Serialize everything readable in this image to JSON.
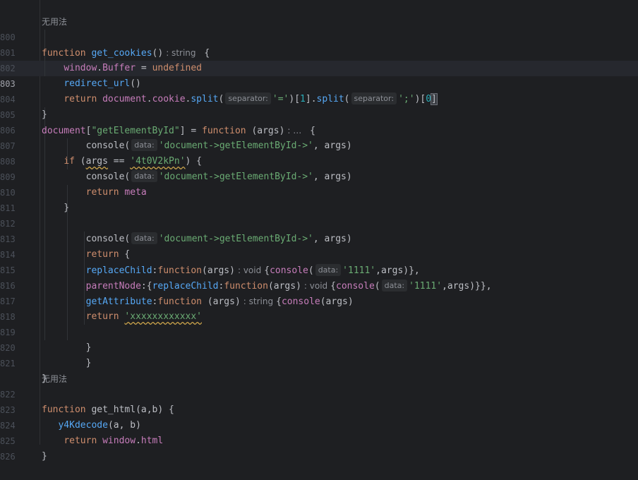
{
  "usage_label_1": "无用法",
  "usage_label_2": "无用法",
  "line_numbers": [
    "800",
    "801",
    "802",
    "803",
    "804",
    "805",
    "806",
    "807",
    "808",
    "809",
    "810",
    "811",
    "812",
    "813",
    "814",
    "815",
    "816",
    "817",
    "818",
    "819",
    "820",
    "821",
    "822",
    "823",
    "824",
    "825",
    "826"
  ],
  "hints": {
    "data": "data:",
    "separator": "separator:",
    "type_string": ": string",
    "type_void": ": void",
    "ellipsis": ": …"
  },
  "code": {
    "l800": {
      "kw": "function",
      "name": "get_cookies",
      "parens": "()"
    },
    "l801": {
      "obj": "window",
      "prop": "Buffer",
      "eq": " = ",
      "val": "undefined"
    },
    "l802": {
      "call": "redirect_url",
      "parens": "()"
    },
    "l803": {
      "kw": "return",
      "doc": "document",
      "prop": "cookie",
      "split": "split",
      "sep1": "'='",
      "idx1": "1",
      "sep2": "';'",
      "idx2": "0"
    },
    "l805": {
      "doc": "document",
      "key": "\"getElementById\"",
      "eq": "] = ",
      "kw": "function",
      "args": " (args)"
    },
    "l806": {
      "fn": "console",
      "str": "'document->getElementById->'",
      "rest": ", args)"
    },
    "l807": {
      "kw": "if",
      "var": "args",
      "op": " == ",
      "str": "'4t0V2kPn'",
      "rest": ") {"
    },
    "l808": {
      "fn": "console",
      "str": "'document->getElementById->'",
      "rest": ", args)"
    },
    "l809": {
      "kw": "return",
      "val": "meta"
    },
    "l812": {
      "fn": "console",
      "str": "'document->getElementById->'",
      "rest": ", args)"
    },
    "l813": {
      "kw": "return",
      "rest": " {"
    },
    "l814": {
      "prop": "replaceChild",
      "kw": "function",
      "args": "(args)",
      "fn": "console",
      "str": "'1111'",
      "rest": ",args)},"
    },
    "l815": {
      "prop": "parentNode",
      "prop2": "replaceChild",
      "kw": "function",
      "args": "(args)",
      "fn": "console",
      "str": "'1111'",
      "rest": ",args)}},"
    },
    "l816": {
      "prop": "getAttribute",
      "kw": "function",
      "args": " (args)",
      "fn": "console",
      "rest": "(args)"
    },
    "l817": {
      "kw": "return",
      "str": "'xxxxxxxxxxxx'"
    },
    "l822": {
      "kw": "function",
      "name": "get_html",
      "args": "(a,b) {"
    },
    "l823": {
      "fn": "y4Kdecode",
      "args": "(a, b)"
    },
    "l824": {
      "kw": "return",
      "obj": "window",
      "prop": "html"
    }
  }
}
